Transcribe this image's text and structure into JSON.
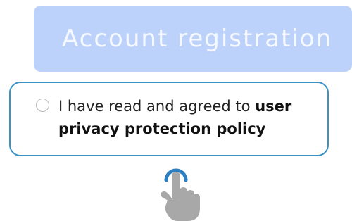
{
  "register_button": {
    "label": "Account registration"
  },
  "agreement": {
    "prefix_text": "I have read and agreed to ",
    "policy_link": "user privacy protection policy",
    "checked": false
  },
  "icons": {
    "radio": "radio-unchecked-icon",
    "pointer": "tap-hand-icon"
  },
  "colors": {
    "button_bg": "#bcd2fb",
    "box_border": "#3a93c3",
    "tap_ring": "#2e7fc0",
    "hand": "#a8a8a8"
  }
}
